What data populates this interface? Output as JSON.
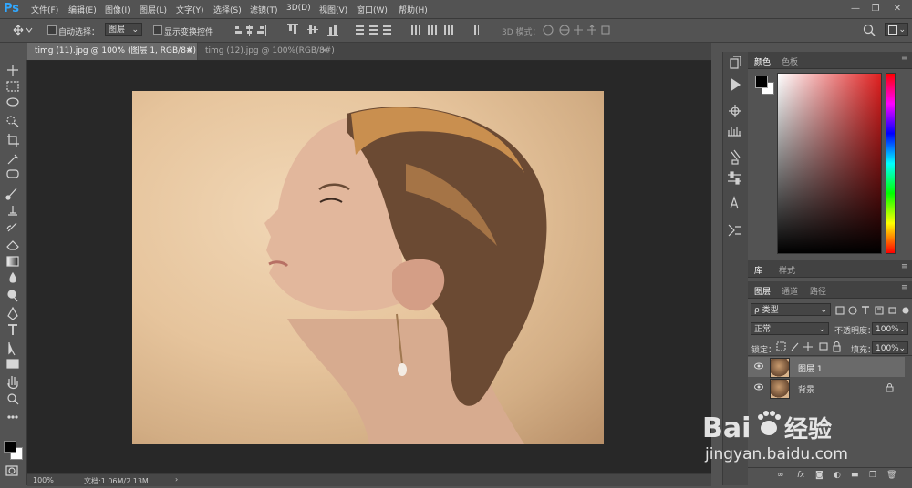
{
  "app": {
    "logo": "Ps"
  },
  "menu": [
    "文件(F)",
    "编辑(E)",
    "图像(I)",
    "图层(L)",
    "文字(Y)",
    "选择(S)",
    "滤镜(T)",
    "3D(D)",
    "视图(V)",
    "窗口(W)",
    "帮助(H)"
  ],
  "window_controls": {
    "minimize": "—",
    "restore": "❐",
    "close": "✕"
  },
  "options": {
    "auto_select_label": "自动选择：",
    "auto_select_value": "图层",
    "show_transform_label": "显示变换控件",
    "mode_3d_label": "3D 模式："
  },
  "tabs": [
    {
      "label": "timg (11).jpg @ 100% (图层 1, RGB/8#) *",
      "close": "×"
    },
    {
      "label": "timg (12).jpg @ 100%(RGB/8#)",
      "close": "×"
    }
  ],
  "status": {
    "zoom": "100%",
    "doc": "文档:1.06M/2.13M",
    "arrow": "›"
  },
  "color_panel": {
    "tabs": [
      "颜色",
      "色板"
    ],
    "foreground": "#000000",
    "background": "#ffffff",
    "hue_accent": "#e02020"
  },
  "library_panel": {
    "tabs": [
      "库",
      "样式"
    ]
  },
  "layers_panel": {
    "tabs": [
      "图层",
      "通道",
      "路径"
    ],
    "filter_label": "ρ 类型",
    "blend_mode": "正常",
    "opacity_label": "不透明度：",
    "opacity_value": "100%",
    "lock_label": "锁定：",
    "fill_label": "填充：",
    "fill_value": "100%",
    "layers": [
      {
        "name": "图层 1",
        "selected": true
      },
      {
        "name": "背景",
        "selected": false
      }
    ],
    "bottom_icons": [
      "link-icon",
      "fx-icon",
      "mask-icon",
      "adjustment-icon",
      "group-icon",
      "new-layer-icon",
      "trash-icon"
    ],
    "fx_label": "fx"
  },
  "watermark": {
    "brand": "Baidu",
    "cn": "经验",
    "url": "jingyan.baidu.com"
  }
}
